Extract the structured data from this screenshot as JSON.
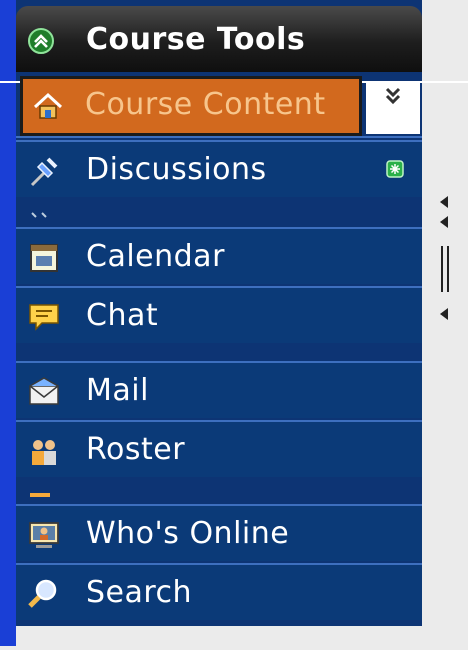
{
  "header": {
    "title": "Course Tools",
    "icon": "double-chevron-up-icon"
  },
  "active_item": {
    "label": "Course Content",
    "icon": "home-icon"
  },
  "collapse_button": {
    "icon": "double-chevron-down-icon"
  },
  "menu": {
    "items": [
      {
        "id": "discussions",
        "label": "Discussions",
        "icon": "pushpin-icon",
        "badge_icon": "green-new-badge-icon"
      },
      {
        "id": "calendar",
        "label": "Calendar",
        "icon": "calendar-icon"
      },
      {
        "id": "chat",
        "label": "Chat",
        "icon": "speech-bubble-icon"
      },
      {
        "id": "mail",
        "label": "Mail",
        "icon": "envelope-icon"
      },
      {
        "id": "roster",
        "label": "Roster",
        "icon": "people-icon"
      },
      {
        "id": "whos_online",
        "label": "Who's Online",
        "icon": "monitor-user-icon"
      },
      {
        "id": "search",
        "label": "Search",
        "icon": "magnifier-icon"
      }
    ]
  },
  "colors": {
    "panel_bg": "#0b3a78",
    "active_bg": "#d2691e",
    "active_text": "#f7c58c",
    "header_bg": "#1e1e1e",
    "rail": "#1a3fd6"
  }
}
